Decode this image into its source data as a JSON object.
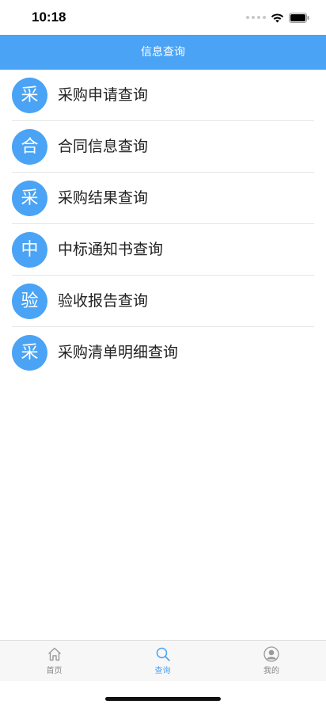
{
  "status_bar": {
    "time": "10:18"
  },
  "nav": {
    "title": "信息查询"
  },
  "menu": [
    {
      "icon_char": "采",
      "label": "采购申请查询"
    },
    {
      "icon_char": "合",
      "label": "合同信息查询"
    },
    {
      "icon_char": "采",
      "label": "采购结果查询"
    },
    {
      "icon_char": "中",
      "label": "中标通知书查询"
    },
    {
      "icon_char": "验",
      "label": "验收报告查询"
    },
    {
      "icon_char": "采",
      "label": "采购清单明细查询"
    }
  ],
  "tabs": [
    {
      "label": "首页",
      "icon": "home-icon",
      "active": false
    },
    {
      "label": "查询",
      "icon": "search-icon",
      "active": true
    },
    {
      "label": "我的",
      "icon": "user-icon",
      "active": false
    }
  ],
  "colors": {
    "accent": "#4aa3f5",
    "tab_inactive": "#888888"
  }
}
